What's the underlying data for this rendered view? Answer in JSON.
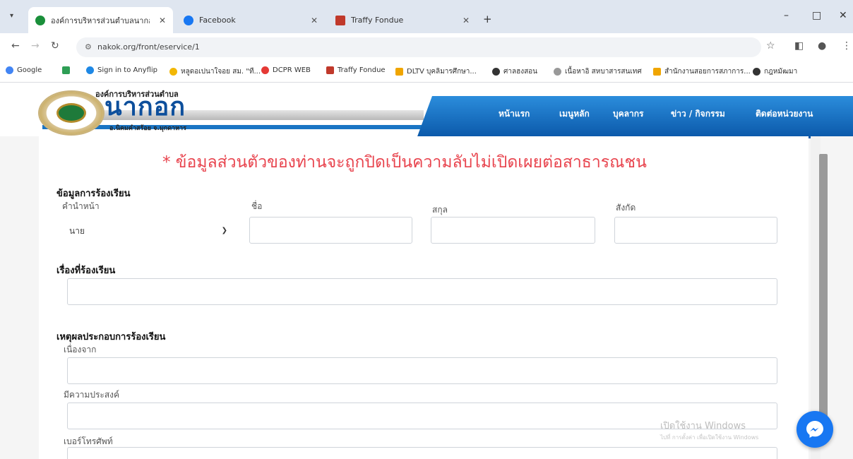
{
  "browser": {
    "tabs": [
      {
        "title": "องค์การบริหารส่วนตำบลนากอก สม",
        "favicon_color": "#1a8f3a"
      },
      {
        "title": "Facebook",
        "favicon_color": "#1877f2"
      },
      {
        "title": "Traffy Fondue",
        "favicon_color": "#c0392b"
      }
    ],
    "new_tab": "+",
    "url": "nakok.org/front/eservice/1",
    "bookmarks": [
      {
        "label": "Google",
        "color": "#4285f4"
      },
      {
        "label": "",
        "color": "#2e9e55"
      },
      {
        "label": "Sign in to Anyflip",
        "color": "#1e88e5"
      },
      {
        "label": "หลูดอเปนาใจอย สม. \"ทื...",
        "color": "#f2b705"
      },
      {
        "label": "DCPR WEB",
        "color": "#e53935"
      },
      {
        "label": "Traffy Fondue",
        "color": "#c0392b"
      },
      {
        "label": "DLTV บุคลิมารศึกษา...",
        "color": "#f0a500"
      },
      {
        "label": "ศาลฮงสอน",
        "color": "#333333"
      },
      {
        "label": "เนื้อหาอิ สหบาสารสนเทศ",
        "color": "#999999"
      },
      {
        "label": "สำนักงานสอยการสภาการ...",
        "color": "#f0a500"
      },
      {
        "label": "กฎหมัฒมา",
        "color": "#333333"
      }
    ]
  },
  "site": {
    "org_name": "องค์การบริหารส่วนตำบล",
    "town_name": "นากอก",
    "town_sub": "อ.นิคมคำสร้อย จ.มุกดาหาร",
    "nav": [
      "หน้าแรก",
      "เมนูหลัก",
      "บุคลากร",
      "ข่าว / กิจกรรม",
      "ติดต่อหน่วยงาน"
    ]
  },
  "form": {
    "notice": "* ข้อมูลส่วนตัวของท่านจะถูกปิดเป็นความลับไม่เปิดเผยต่อสาธารณชน",
    "complainant_section": "ข้อมูลการร้องเรียน",
    "labels": {
      "prefix": "คำนำหน้า",
      "first_name": "ชื่อ",
      "last_name": "สกุล",
      "affiliation": "สังกัด"
    },
    "prefix_selected": "นาย",
    "subject_section": "เรื่องที่ร้องเรียน",
    "reason_section": "เหตุผลประกอบการร้องเรียน",
    "because_label": "เนื่องจาก",
    "purpose_label": "มีความประสงค์",
    "phone_label": "เบอร์โทรศัพท์"
  },
  "overlay": {
    "watermark_title": "เปิดใช้งาน Windows",
    "watermark_sub": "ไปที่ การตั้งค่า เพื่อเปิดใช้งาน Windows"
  }
}
